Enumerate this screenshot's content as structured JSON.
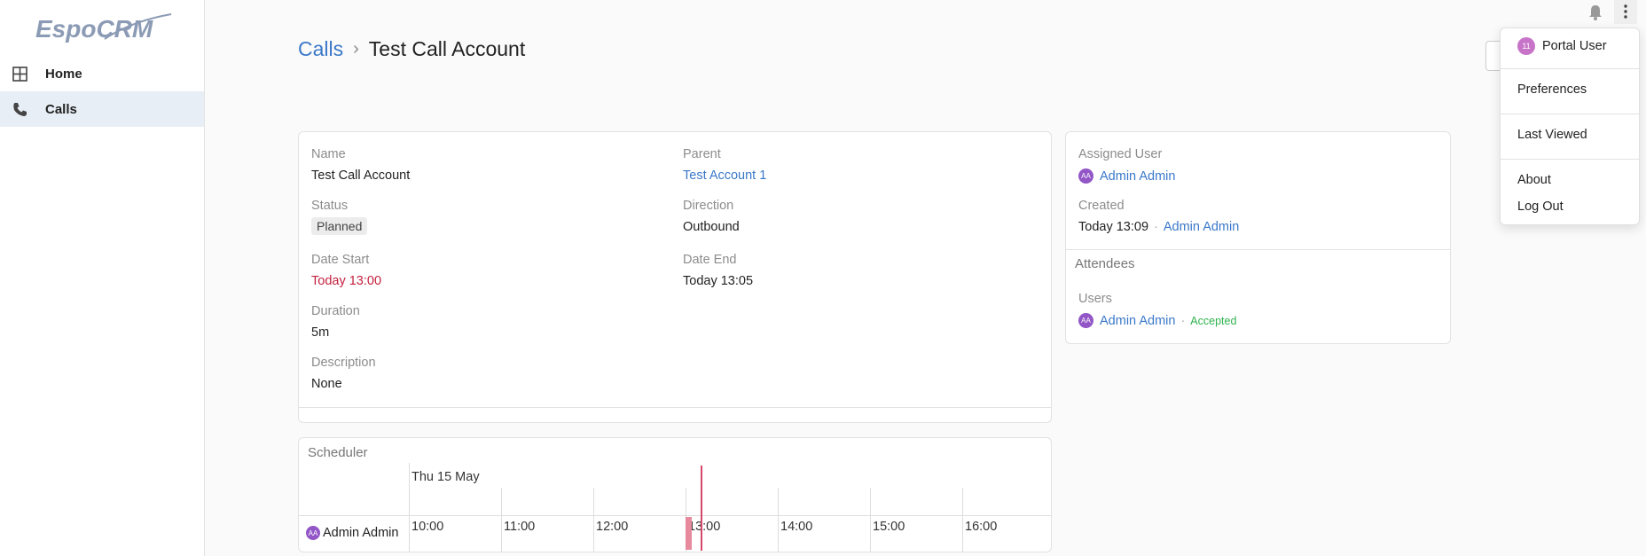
{
  "app": {
    "logo_text": "EspoCRM"
  },
  "sidebar": {
    "items": [
      {
        "label": "Home",
        "icon": "grid-icon"
      },
      {
        "label": "Calls",
        "icon": "phone-icon"
      }
    ]
  },
  "breadcrumb": {
    "parent": "Calls",
    "current": "Test Call Account"
  },
  "detail": {
    "name_label": "Name",
    "name_value": "Test Call Account",
    "parent_label": "Parent",
    "parent_value": "Test Account 1",
    "status_label": "Status",
    "status_value": "Planned",
    "direction_label": "Direction",
    "direction_value": "Outbound",
    "date_start_label": "Date Start",
    "date_start_value": "Today 13:00",
    "date_end_label": "Date End",
    "date_end_value": "Today 13:05",
    "duration_label": "Duration",
    "duration_value": "5m",
    "description_label": "Description",
    "description_value": "None"
  },
  "side": {
    "assigned_user_label": "Assigned User",
    "assigned_user_value": "Admin Admin",
    "assigned_user_initials": "AA",
    "created_label": "Created",
    "created_time": "Today 13:09",
    "created_by": "Admin Admin",
    "attendees_title": "Attendees",
    "users_label": "Users",
    "attendee_name": "Admin Admin",
    "attendee_initials": "AA",
    "attendee_status": "Accepted"
  },
  "scheduler": {
    "title": "Scheduler",
    "date": "Thu 15 May",
    "hours": [
      "10:00",
      "11:00",
      "12:00",
      "13:00",
      "14:00",
      "15:00",
      "16:00"
    ],
    "user": "Admin Admin",
    "user_initials": "AA"
  },
  "menu": {
    "user_label": "Portal User",
    "user_initials": "11",
    "preferences": "Preferences",
    "last_viewed": "Last Viewed",
    "about": "About",
    "logout": "Log Out"
  },
  "colors": {
    "link": "#3a78c9",
    "accent_red": "#c3213e",
    "accepted_green": "#2eb24d",
    "avatar_purple": "#9256c7"
  }
}
